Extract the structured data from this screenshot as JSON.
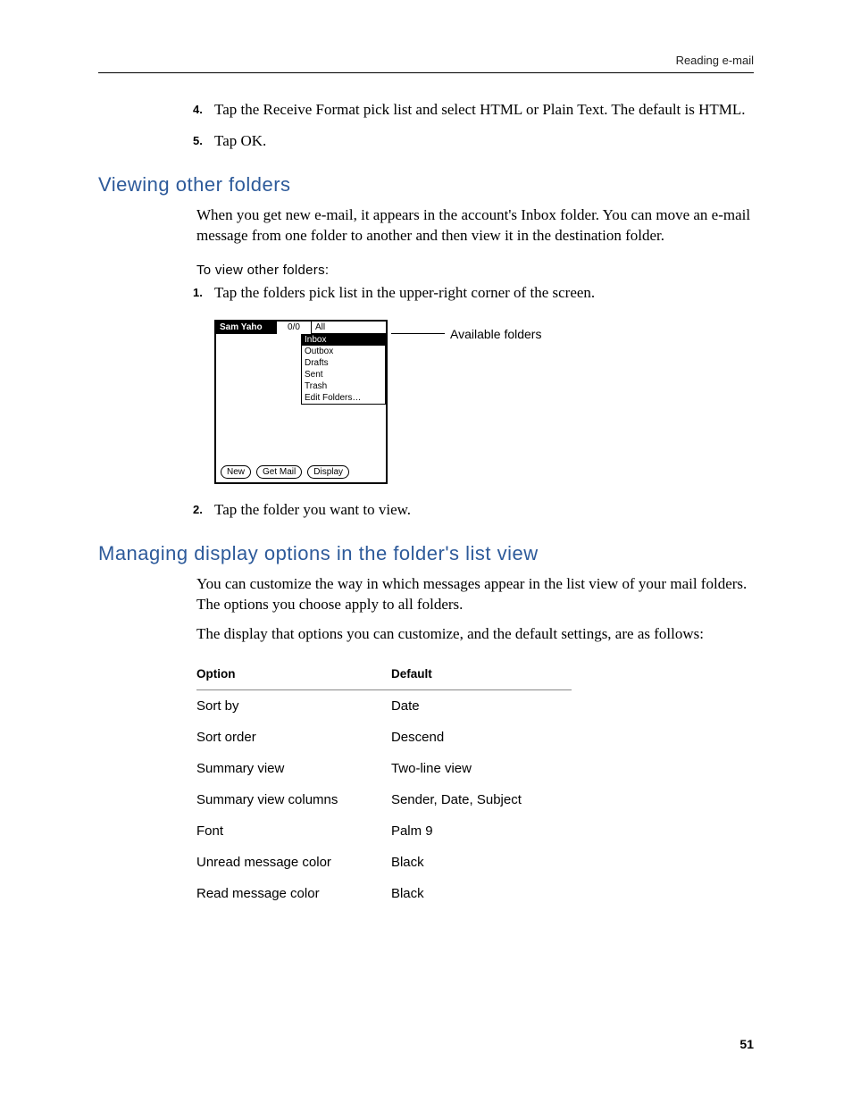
{
  "runningHead": "Reading e-mail",
  "pageNumber": "51",
  "topSteps": [
    {
      "n": "4.",
      "text": "Tap the Receive Format pick list and select HTML or Plain Text. The default is HTML."
    },
    {
      "n": "5.",
      "text": "Tap OK."
    }
  ],
  "sectionA": {
    "title": "Viewing other folders",
    "intro": "When you get new e-mail, it appears in the account's Inbox folder. You can move an e-mail message from one folder to another and then view it in the destination folder.",
    "procHeading": "To view other folders:",
    "steps": [
      {
        "n": "1.",
        "text": "Tap the folders pick list in the upper-right corner of the screen."
      },
      {
        "n": "2.",
        "text": "Tap the folder you want to view."
      }
    ]
  },
  "figure": {
    "account": "Sam Yaho",
    "count": "0/0",
    "picklist": "All",
    "menu": [
      "Inbox",
      "Outbox",
      "Drafts",
      "Sent",
      "Trash",
      "Edit Folders…"
    ],
    "buttons": [
      "New",
      "Get Mail",
      "Display"
    ],
    "callout": "Available folders"
  },
  "sectionB": {
    "title": "Managing display options in the folder's list view",
    "para1": "You can customize the way in which messages appear in the list view of your mail folders. The options you choose apply to all folders.",
    "para2": "The display that options you can customize, and the default settings, are as follows:",
    "tableHead": {
      "c1": "Option",
      "c2": "Default"
    },
    "rows": [
      {
        "c1": "Sort by",
        "c2": "Date"
      },
      {
        "c1": "Sort order",
        "c2": "Descend"
      },
      {
        "c1": "Summary view",
        "c2": "Two-line view"
      },
      {
        "c1": "Summary view columns",
        "c2": "Sender, Date, Subject"
      },
      {
        "c1": "Font",
        "c2": "Palm 9"
      },
      {
        "c1": "Unread message color",
        "c2": "Black"
      },
      {
        "c1": "Read message color",
        "c2": "Black"
      }
    ]
  }
}
